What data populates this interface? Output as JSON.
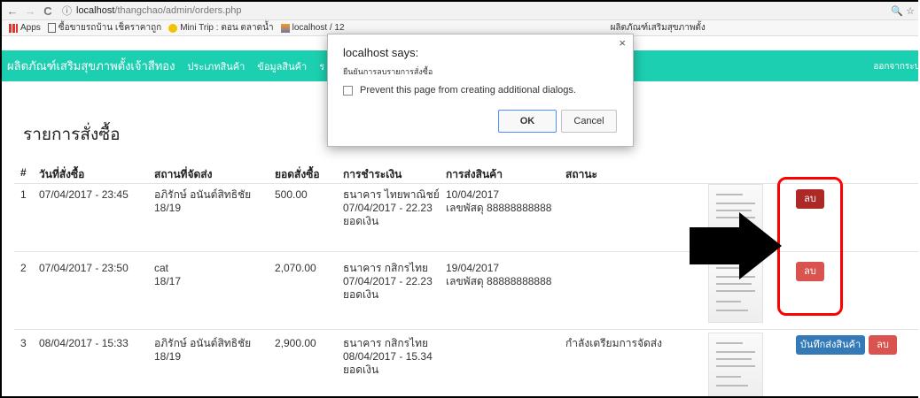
{
  "browser": {
    "back": "←",
    "forward": "→",
    "reload": "C",
    "info": "ⓘ",
    "url_host": "localhost",
    "url_path": "/thangchao/admin/orders.php",
    "right_icons": "🔍 ☆"
  },
  "bookmarks": [
    {
      "label": "Apps",
      "icon": "apps-icon"
    },
    {
      "label": "ซื้อขายรถบ้าน เช็คราคาถูก",
      "icon": "page-icon"
    },
    {
      "label": "Mini Trip : ตอน ตลาดน้ำ",
      "icon": "smiley-icon"
    },
    {
      "label": "localhost / 12",
      "icon": "phpmyadmin-icon"
    },
    {
      "label": "ผลิตภัณฑ์เสริมสุขภาพตั้ง",
      "icon": "page-icon"
    }
  ],
  "site": {
    "brand": "ผลิตภัณฑ์เสริมสุขภาพตั้งเจ้าสีทอง",
    "nav": [
      "ประเภทสินค้า",
      "ข้อมูลสินค้า",
      "ร"
    ],
    "logout": "ออกจากระบ"
  },
  "page": {
    "title": "รายการสั่งซื้อ",
    "columns": [
      "#",
      "วันที่สั่งซื้อ",
      "สถานที่จัดส่ง",
      "ยอดสั่งซื้อ",
      "การชำระเงิน",
      "การส่งสินค้า",
      "สถานะ"
    ]
  },
  "orders": [
    {
      "num": "1",
      "date": "07/04/2017 - 23:45",
      "address1": "อภิรักษ์ อนันต์สิทธิชัย",
      "address2": "18/19",
      "total": "500.00",
      "pay1": "ธนาคาร ไทยพาณิชย์",
      "pay2": "07/04/2017 - 22.23",
      "pay3": "ยอดเงิน",
      "ship1": "10/04/2017",
      "ship2": "เลขพัสดุ 88888888888",
      "status": "",
      "delete_label": "ลบ"
    },
    {
      "num": "2",
      "date": "07/04/2017 - 23:50",
      "address1": "cat",
      "address2": "18/17",
      "total": "2,070.00",
      "pay1": "ธนาคาร กสิกรไทย",
      "pay2": "07/04/2017 - 22.23",
      "pay3": "ยอดเงิน",
      "ship1": "19/04/2017",
      "ship2": "เลขพัสดุ 88888888888",
      "status": "",
      "delete_label": "ลบ"
    },
    {
      "num": "3",
      "date": "08/04/2017 - 15:33",
      "address1": "อภิรักษ์ อนันต์สิทธิชัย",
      "address2": "18/19",
      "total": "2,900.00",
      "pay1": "ธนาคาร กสิกรไทย",
      "pay2": "08/04/2017 - 15.34",
      "pay3": "ยอดเงิน",
      "ship1": "",
      "ship2": "",
      "status": "กำลังเตรียมการจัดส่ง",
      "ship_button": "บันทึกส่งสินค้า",
      "delete_label": "ลบ"
    }
  ],
  "dialog": {
    "title": "localhost says:",
    "message": "ยืนยันการลบรายการสั่งซื้อ",
    "checkbox_label": "Prevent this page from creating additional dialogs.",
    "ok": "OK",
    "cancel": "Cancel",
    "close": "×"
  },
  "colors": {
    "navbar": "#1ccfb0",
    "delete": "#d9534f",
    "delete_active": "#ac2925",
    "ship": "#337ab7",
    "highlight": "#ff0000"
  }
}
